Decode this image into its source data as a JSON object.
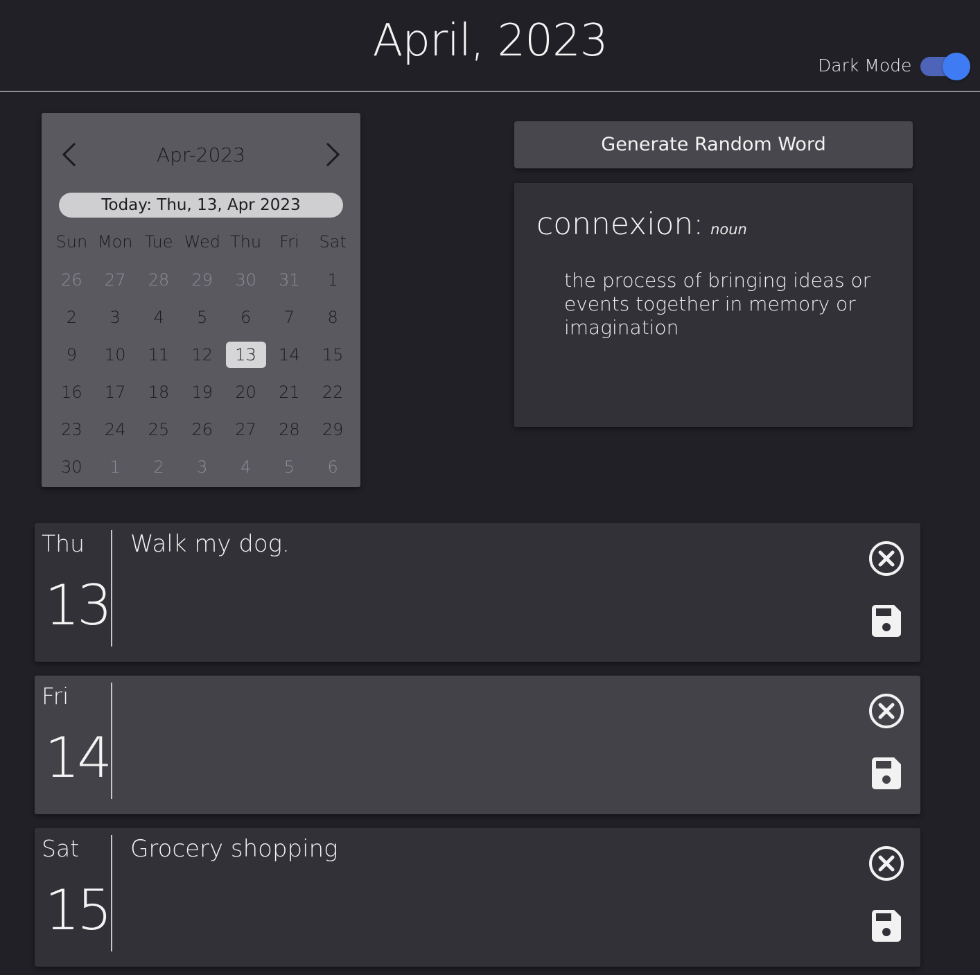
{
  "header": {
    "title": "April, 2023",
    "dark_mode_label": "Dark Mode",
    "dark_mode_on": true
  },
  "calendar": {
    "month_label": "Apr-2023",
    "today_label": "Today: Thu, 13, Apr 2023",
    "weekdays": [
      "Sun",
      "Mon",
      "Tue",
      "Wed",
      "Thu",
      "Fri",
      "Sat"
    ],
    "weeks": [
      [
        "26",
        "27",
        "28",
        "29",
        "30",
        "31",
        "1"
      ],
      [
        "2",
        "3",
        "4",
        "5",
        "6",
        "7",
        "8"
      ],
      [
        "9",
        "10",
        "11",
        "12",
        "13",
        "14",
        "15"
      ],
      [
        "16",
        "17",
        "18",
        "19",
        "20",
        "21",
        "22"
      ],
      [
        "23",
        "24",
        "25",
        "26",
        "27",
        "28",
        "29"
      ],
      [
        "30",
        "1",
        "2",
        "3",
        "4",
        "5",
        "6"
      ]
    ],
    "selected_day": "13"
  },
  "word_panel": {
    "button_label": "Generate Random Word",
    "word": "connexion:",
    "part_of_speech": "noun",
    "definition": "the process of bringing ideas or events together in memory or imagination"
  },
  "days": [
    {
      "name": "Thu",
      "number": "13",
      "note": "Walk my dog."
    },
    {
      "name": "Fri",
      "number": "14",
      "note": ""
    },
    {
      "name": "Sat",
      "number": "15",
      "note": "Grocery shopping"
    }
  ],
  "colors": {
    "background": "#212026",
    "toggle_track": "#4d64b8",
    "toggle_knob": "#3f7cf3"
  }
}
